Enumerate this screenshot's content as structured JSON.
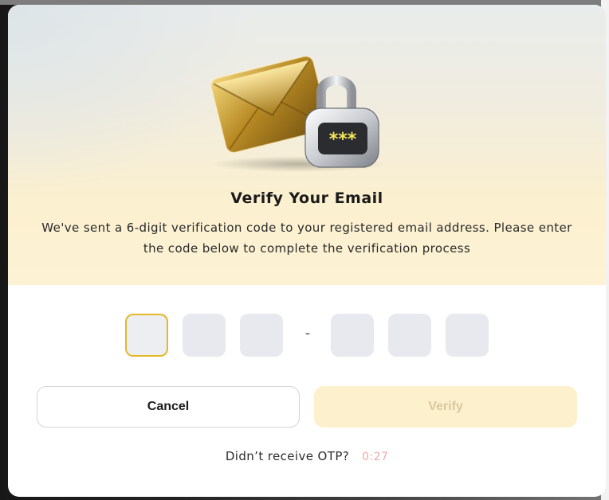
{
  "modal": {
    "title": "Verify Your Email",
    "description": "We've sent a 6-digit verification code to your registered email address. Please enter the code below to complete the verification process",
    "illustration_icon": "envelope-lock-icon",
    "lock_code_display": "***"
  },
  "otp": {
    "digits": [
      "",
      "",
      "",
      "",
      "",
      ""
    ],
    "separator": "-",
    "active_index": 0,
    "active_border_color": "#e4b928"
  },
  "actions": {
    "cancel_label": "Cancel",
    "verify_label": "Verify",
    "verify_disabled": true
  },
  "resend": {
    "prompt": "Didn’t receive OTP?",
    "timer": "0:27",
    "timer_color": "#f3a8a8"
  }
}
